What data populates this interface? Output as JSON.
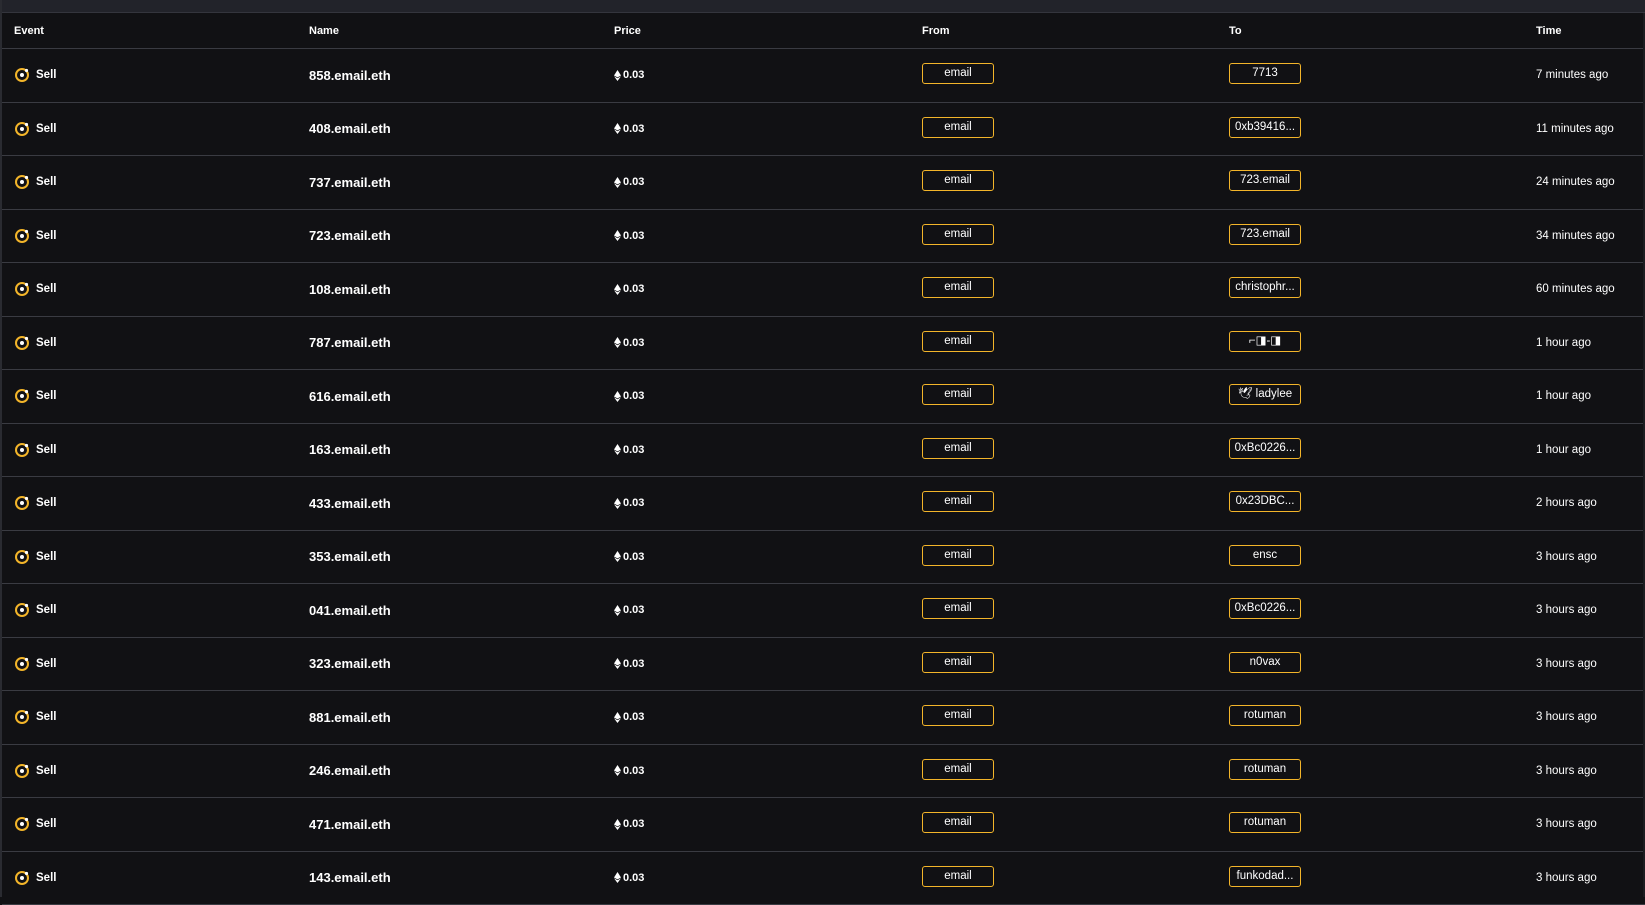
{
  "header": {
    "event": "Event",
    "name": "Name",
    "price": "Price",
    "from": "From",
    "to": "To",
    "time": "Time"
  },
  "colors": {
    "accent": "#f3b52a",
    "background": "#111114",
    "divider": "#3a3b42"
  },
  "icons": {
    "event": "sell-target-icon",
    "price": "ethereum-icon"
  },
  "rows": [
    {
      "event": "Sell",
      "name": "858.email.eth",
      "price": "0.03",
      "from": "email",
      "to": "7713",
      "time": "7 minutes ago"
    },
    {
      "event": "Sell",
      "name": "408.email.eth",
      "price": "0.03",
      "from": "email",
      "to": "0xb39416...",
      "time": "11 minutes ago"
    },
    {
      "event": "Sell",
      "name": "737.email.eth",
      "price": "0.03",
      "from": "email",
      "to": "723.email",
      "time": "24 minutes ago"
    },
    {
      "event": "Sell",
      "name": "723.email.eth",
      "price": "0.03",
      "from": "email",
      "to": "723.email",
      "time": "34 minutes ago"
    },
    {
      "event": "Sell",
      "name": "108.email.eth",
      "price": "0.03",
      "from": "email",
      "to": "christophr...",
      "time": "60 minutes ago"
    },
    {
      "event": "Sell",
      "name": "787.email.eth",
      "price": "0.03",
      "from": "email",
      "to": "⌐◨-◨",
      "time": "1 hour ago"
    },
    {
      "event": "Sell",
      "name": "616.email.eth",
      "price": "0.03",
      "from": "email",
      "to": "🕊 ladylee",
      "time": "1 hour ago"
    },
    {
      "event": "Sell",
      "name": "163.email.eth",
      "price": "0.03",
      "from": "email",
      "to": "0xBc0226...",
      "time": "1 hour ago"
    },
    {
      "event": "Sell",
      "name": "433.email.eth",
      "price": "0.03",
      "from": "email",
      "to": "0x23DBC...",
      "time": "2 hours ago"
    },
    {
      "event": "Sell",
      "name": "353.email.eth",
      "price": "0.03",
      "from": "email",
      "to": "ensc",
      "time": "3 hours ago"
    },
    {
      "event": "Sell",
      "name": "041.email.eth",
      "price": "0.03",
      "from": "email",
      "to": "0xBc0226...",
      "time": "3 hours ago"
    },
    {
      "event": "Sell",
      "name": "323.email.eth",
      "price": "0.03",
      "from": "email",
      "to": "n0vax",
      "time": "3 hours ago"
    },
    {
      "event": "Sell",
      "name": "881.email.eth",
      "price": "0.03",
      "from": "email",
      "to": "rotuman",
      "time": "3 hours ago"
    },
    {
      "event": "Sell",
      "name": "246.email.eth",
      "price": "0.03",
      "from": "email",
      "to": "rotuman",
      "time": "3 hours ago"
    },
    {
      "event": "Sell",
      "name": "471.email.eth",
      "price": "0.03",
      "from": "email",
      "to": "rotuman",
      "time": "3 hours ago"
    },
    {
      "event": "Sell",
      "name": "143.email.eth",
      "price": "0.03",
      "from": "email",
      "to": "funkodad...",
      "time": "3 hours ago"
    }
  ]
}
